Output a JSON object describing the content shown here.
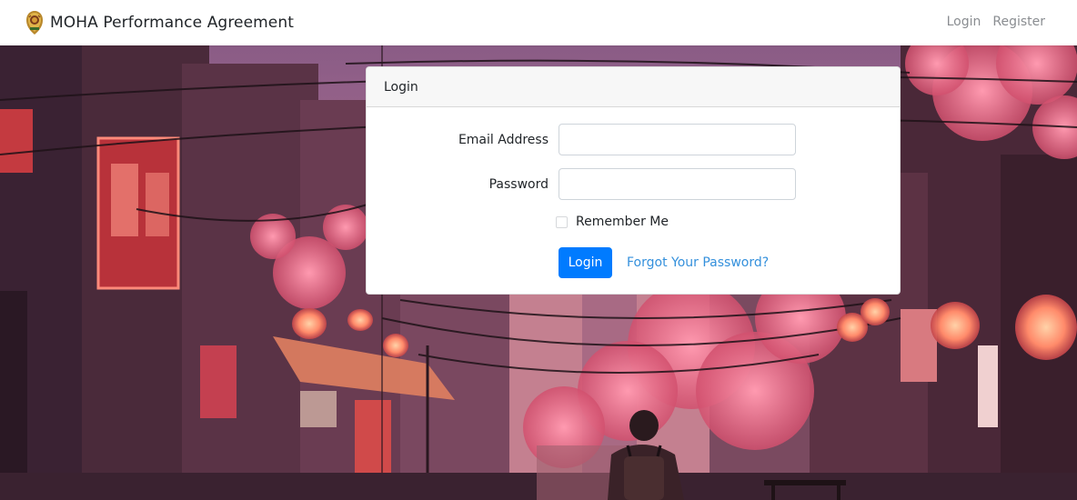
{
  "app": {
    "title": "MOHA Performance Agreement",
    "logo_icon": "emblem-icon"
  },
  "nav": {
    "links": [
      {
        "label": "Login"
      },
      {
        "label": "Register"
      }
    ]
  },
  "login_card": {
    "header": "Login",
    "email_label": "Email Address",
    "email_value": "",
    "email_placeholder": "",
    "password_label": "Password",
    "password_value": "",
    "password_placeholder": "",
    "remember_label": "Remember Me",
    "remember_checked": false,
    "submit_label": "Login",
    "forgot_label": "Forgot Your Password?"
  },
  "colors": {
    "primary": "#007bff",
    "link": "#3490dc",
    "nav_link": "#8a8d91",
    "card_header_bg": "#f7f7f7"
  }
}
